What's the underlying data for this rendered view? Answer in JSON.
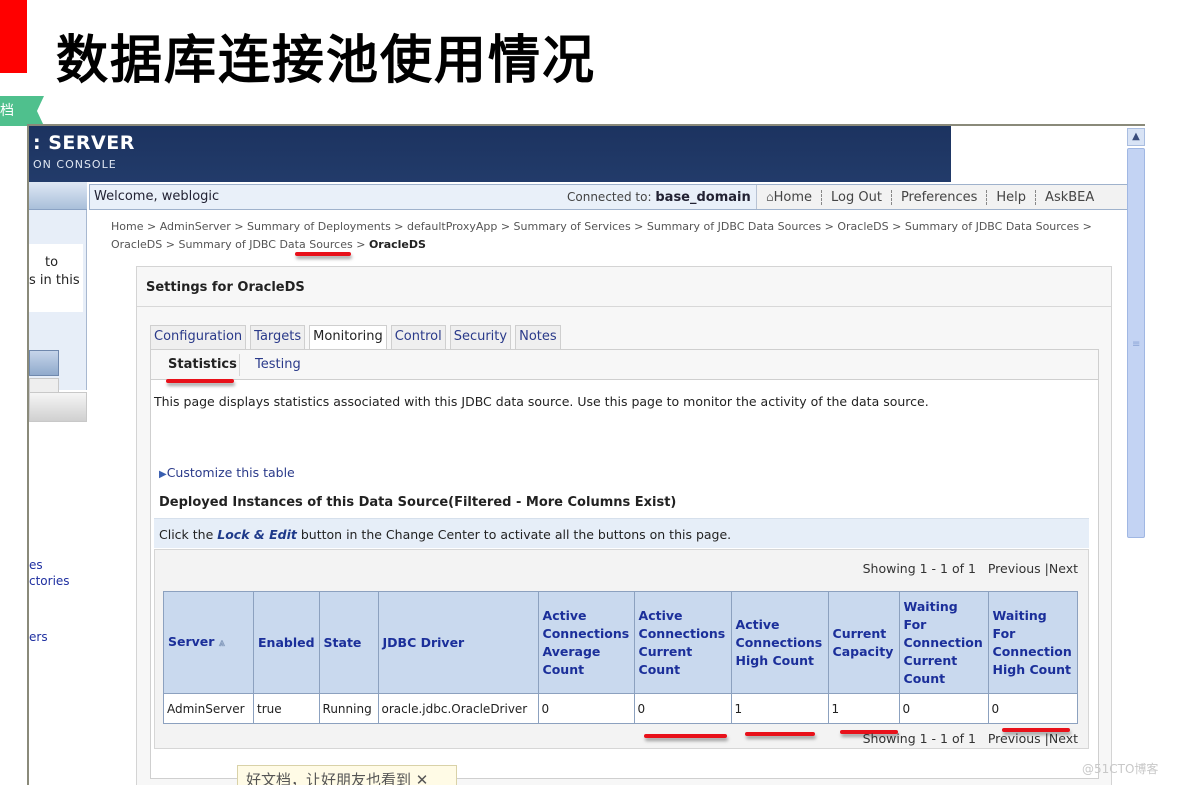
{
  "slide": {
    "title": "数据库连接池使用情况",
    "side_tag": "档",
    "watermark": "@51CTO博客",
    "share_tip": "好文档，让好朋友也看到 ✕"
  },
  "console": {
    "banner_title": ": SERVER",
    "banner_subtitle": "ON CONSOLE",
    "left_panel": {
      "text_line1": "to",
      "text_line2": "s in this",
      "links": [
        "es",
        "ctories",
        "ers"
      ]
    },
    "welcome": "Welcome, weblogic",
    "connected_label": "Connected to:",
    "connected_domain": "base_domain",
    "nav": {
      "home": "Home",
      "logout": "Log Out",
      "preferences": "Preferences",
      "help": "Help",
      "askbea": "AskBEA"
    },
    "breadcrumb": {
      "path": "Home > AdminServer > Summary of Deployments > defaultProxyApp > Summary of Services > Summary of JDBC Data Sources > OracleDS > Summary of JDBC Data Sources > OracleDS > Summary of JDBC Data Sources > ",
      "current": "OracleDS"
    },
    "settings_title": "Settings for OracleDS",
    "tabs": [
      "Configuration",
      "Targets",
      "Monitoring",
      "Control",
      "Security",
      "Notes"
    ],
    "active_tab": "Monitoring",
    "subtabs": [
      "Statistics",
      "Testing"
    ],
    "active_subtab": "Statistics",
    "description": "This page displays statistics associated with this JDBC data source. Use this page to monitor the activity of the data source.",
    "customize": "Customize this table",
    "deployed_title": "Deployed Instances of this Data Source(Filtered - More Columns Exist)",
    "lock_prefix": "Click the ",
    "lock_link": "Lock & Edit",
    "lock_suffix": " button in the Change Center to activate all the buttons on this page.",
    "showing": "Showing 1 - 1 of 1",
    "previous": "Previous",
    "next": "Next",
    "table": {
      "headers": [
        "Server",
        "Enabled",
        "State",
        "JDBC Driver",
        "Active Connections Average Count",
        "Active Connections Current Count",
        "Active Connections High Count",
        "Current Capacity",
        "Waiting For Connection Current Count",
        "Waiting For Connection High Count"
      ],
      "rows": [
        [
          "AdminServer",
          "true",
          "Running",
          "oracle.jdbc.OracleDriver",
          "0",
          "0",
          "1",
          "1",
          "0",
          "0"
        ]
      ]
    }
  }
}
